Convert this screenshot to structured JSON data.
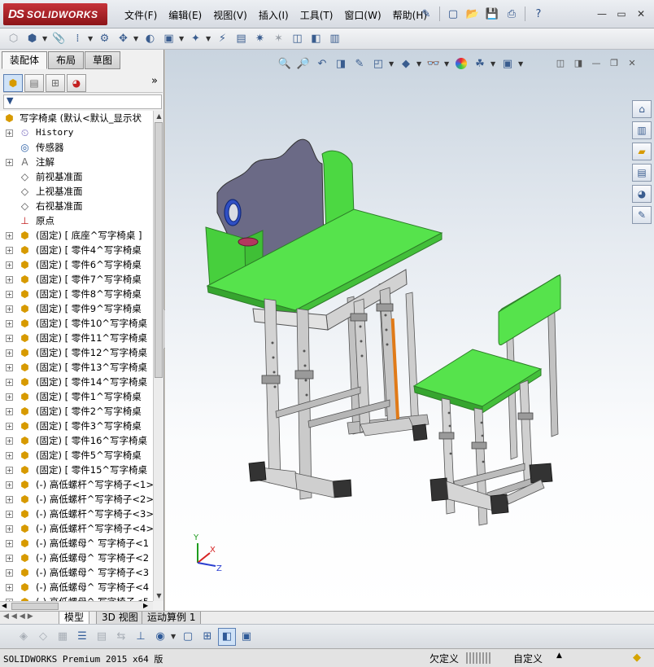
{
  "app": {
    "logo_ds": "DS",
    "logo_text": "SOLIDWORKS",
    "menus": [
      "文件(F)",
      "编辑(E)",
      "视图(V)",
      "插入(I)",
      "工具(T)",
      "窗口(W)",
      "帮助(H)"
    ]
  },
  "panel": {
    "tabs": [
      "装配体",
      "布局",
      "草图"
    ],
    "more": "»",
    "filter_icon": "▼",
    "tree_root": "写字椅桌  (默认<默认_显示状",
    "tree": [
      {
        "type": "history",
        "label": "History",
        "expand": "+"
      },
      {
        "type": "sensor",
        "label": "传感器",
        "expand": ""
      },
      {
        "type": "annotation",
        "label": "注解",
        "expand": "+"
      },
      {
        "type": "plane",
        "label": "前视基准面",
        "expand": ""
      },
      {
        "type": "plane",
        "label": "上视基准面",
        "expand": ""
      },
      {
        "type": "plane",
        "label": "右视基准面",
        "expand": ""
      },
      {
        "type": "origin",
        "label": "原点",
        "expand": ""
      },
      {
        "type": "part",
        "label": "(固定) [ 底座^写字椅桌 ]",
        "expand": "+"
      },
      {
        "type": "part",
        "label": "(固定) [ 零件4^写字椅桌",
        "expand": "+"
      },
      {
        "type": "part",
        "label": "(固定) [ 零件6^写字椅桌",
        "expand": "+"
      },
      {
        "type": "part",
        "label": "(固定) [ 零件7^写字椅桌",
        "expand": "+"
      },
      {
        "type": "part",
        "label": "(固定) [ 零件8^写字椅桌",
        "expand": "+"
      },
      {
        "type": "part",
        "label": "(固定) [ 零件9^写字椅桌",
        "expand": "+"
      },
      {
        "type": "part",
        "label": "(固定) [ 零件10^写字椅桌",
        "expand": "+"
      },
      {
        "type": "part",
        "label": "(固定) [ 零件11^写字椅桌",
        "expand": "+"
      },
      {
        "type": "part",
        "label": "(固定) [ 零件12^写字椅桌",
        "expand": "+"
      },
      {
        "type": "part",
        "label": "(固定) [ 零件13^写字椅桌",
        "expand": "+"
      },
      {
        "type": "part",
        "label": "(固定) [ 零件14^写字椅桌",
        "expand": "+"
      },
      {
        "type": "part",
        "label": "(固定) [ 零件1^写字椅桌",
        "expand": "+"
      },
      {
        "type": "part",
        "label": "(固定) [ 零件2^写字椅桌",
        "expand": "+"
      },
      {
        "type": "part",
        "label": "(固定) [ 零件3^写字椅桌",
        "expand": "+"
      },
      {
        "type": "part",
        "label": "(固定) [ 零件16^写字椅桌",
        "expand": "+"
      },
      {
        "type": "part",
        "label": "(固定) [ 零件5^写字椅桌",
        "expand": "+"
      },
      {
        "type": "part",
        "label": "(固定) [ 零件15^写字椅桌",
        "expand": "+"
      },
      {
        "type": "part",
        "label": "(-) 高低螺杆^写字椅子<1>",
        "expand": "+"
      },
      {
        "type": "part",
        "label": "(-) 高低螺杆^写字椅子<2>",
        "expand": "+"
      },
      {
        "type": "part",
        "label": "(-) 高低螺杆^写字椅子<3>",
        "expand": "+"
      },
      {
        "type": "part",
        "label": "(-) 高低螺杆^写字椅子<4>",
        "expand": "+"
      },
      {
        "type": "part",
        "label": "(-) 高低螺母^ 写字椅子<1",
        "expand": "+"
      },
      {
        "type": "part",
        "label": "(-) 高低螺母^ 写字椅子<2",
        "expand": "+"
      },
      {
        "type": "part",
        "label": "(-) 高低螺母^ 写字椅子<3",
        "expand": "+"
      },
      {
        "type": "part",
        "label": "(-) 高低螺母^ 写字椅子<4",
        "expand": "+"
      },
      {
        "type": "part",
        "label": "(-) 高低螺母^ 写字椅子<5",
        "expand": "+"
      }
    ]
  },
  "bottom_tabs": [
    "模型",
    "3D 视图",
    "运动算例 1"
  ],
  "status": {
    "product": "SOLIDWORKS Premium 2015 x64 版",
    "definition": "欠定义",
    "units": "自定义",
    "arrow": "▲"
  },
  "colors": {
    "desk_top": "#56e34c",
    "desk_edge": "#3aa334",
    "board": "#6b6a86",
    "frame": "#c9c9c9",
    "foot": "#333333",
    "accent": "#e07a18"
  },
  "triad": {
    "x": "X",
    "y": "Y",
    "z": "Z"
  }
}
